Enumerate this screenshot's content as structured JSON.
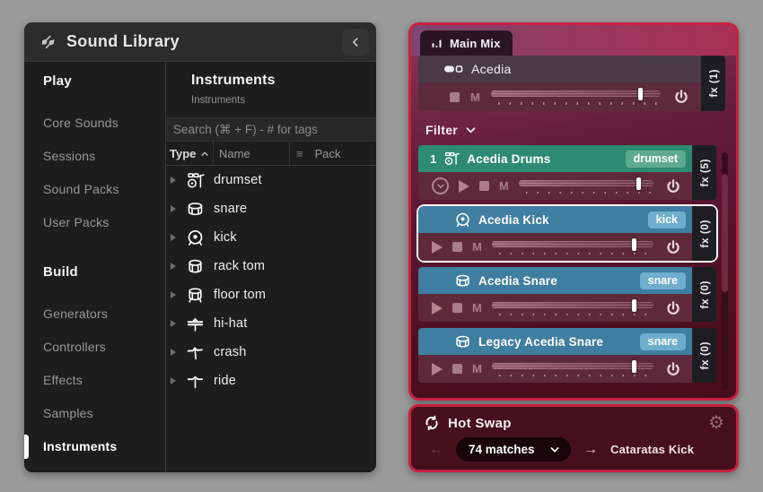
{
  "library": {
    "title": "Sound Library",
    "sidebar": {
      "play_heading": "Play",
      "build_heading": "Build",
      "play_items": [
        {
          "label": "Core Sounds"
        },
        {
          "label": "Sessions"
        },
        {
          "label": "Sound Packs"
        },
        {
          "label": "User Packs"
        }
      ],
      "build_items": [
        {
          "label": "Generators"
        },
        {
          "label": "Controllers"
        },
        {
          "label": "Effects"
        },
        {
          "label": "Samples"
        },
        {
          "label": "Instruments",
          "selected": true
        }
      ]
    },
    "content": {
      "title": "Instruments",
      "breadcrumb": "Instruments",
      "search_placeholder": "Search (⌘ + F) - # for tags",
      "columns": {
        "type": "Type",
        "name": "Name",
        "pack": "Pack"
      },
      "rows": [
        {
          "icon": "drumset-icon",
          "name": "drumset"
        },
        {
          "icon": "snare-icon",
          "name": "snare"
        },
        {
          "icon": "kick-icon",
          "name": "kick"
        },
        {
          "icon": "rack-tom-icon",
          "name": "rack tom"
        },
        {
          "icon": "floor-tom-icon",
          "name": "floor tom"
        },
        {
          "icon": "hi-hat-icon",
          "name": "hi-hat"
        },
        {
          "icon": "crash-icon",
          "name": "crash"
        },
        {
          "icon": "ride-icon",
          "name": "ride"
        }
      ]
    }
  },
  "mixer": {
    "tab_label": "Main Mix",
    "filter_label": "Filter",
    "mute_label": "M",
    "fader_pct": 86,
    "master": {
      "name": "Acedia",
      "fx_label": "fx (1)"
    },
    "tracks": [
      {
        "index": "1",
        "name": "Acedia Drums",
        "badge": "drumset",
        "fx_label": "fx (5)",
        "color": "#2e8b73",
        "badge_color": "#5fa98f",
        "selected": false
      },
      {
        "name": "Acedia Kick",
        "badge": "kick",
        "fx_label": "fx (0)",
        "color": "#3f7ea0",
        "badge_color": "#6fadcd",
        "selected": true
      },
      {
        "name": "Acedia Snare",
        "badge": "snare",
        "fx_label": "fx (0)",
        "color": "#3f7ea0",
        "badge_color": "#6fadcd",
        "selected": false
      },
      {
        "name": "Legacy Acedia Snare",
        "badge": "snare",
        "fx_label": "fx (0)",
        "color": "#3f7ea0",
        "badge_color": "#6fadcd",
        "selected": false
      }
    ]
  },
  "hotswap": {
    "title": "Hot Swap",
    "matches_label": "74 matches",
    "target_label": "Cataratas Kick"
  },
  "icons": {
    "gear": "⚙",
    "arrow_left": "←",
    "arrow_right": "→",
    "column_menu": "≡"
  },
  "colors": {
    "page_background": "#9b9b9b",
    "library_background": "#1d1d1d",
    "accent_red_border": "#c7213f",
    "track_green": "#2e8b73",
    "track_blue": "#3f7ea0",
    "controls_maroon": "#5e2a39",
    "selection_ring": "#ffffff"
  }
}
